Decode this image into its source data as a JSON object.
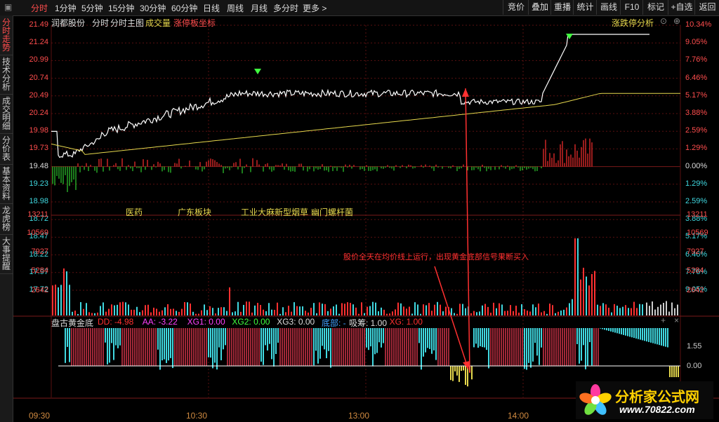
{
  "toolbar": {
    "corner": "▣",
    "periods": [
      "分时",
      "1分钟",
      "5分钟",
      "15分钟",
      "30分钟",
      "60分钟",
      "日线",
      "周线",
      "月线",
      "多分时",
      "更多 >"
    ],
    "right_buttons": [
      "竞价",
      "叠加",
      "重播",
      "统计",
      "画线",
      "F10",
      "标记",
      "+自选",
      "返回"
    ]
  },
  "left_tabs": [
    "分时走势",
    "技术分析",
    "成交明细",
    "分价表",
    "基本资料",
    "龙虎榜",
    "大事提醒"
  ],
  "header": {
    "stock": "润都股份",
    "mode": "分时",
    "main_chart": "分时主图",
    "volume_label": "成交量",
    "limit_label": "涨停板坐标",
    "analysis_link": "涨跌停分析"
  },
  "price_axis": {
    "left": [
      "21.49",
      "21.24",
      "20.99",
      "20.74",
      "20.49",
      "20.24",
      "19.98",
      "19.73",
      "19.48",
      "19.23",
      "18.98",
      "18.72",
      "18.47",
      "18.22",
      "17.97",
      "17.72"
    ],
    "right": [
      "10.34%",
      "9.05%",
      "7.76%",
      "6.46%",
      "5.17%",
      "3.88%",
      "2.59%",
      "1.29%",
      "0.00%",
      "1.29%",
      "2.59%",
      "3.88%",
      "5.17%",
      "6.46%",
      "7.76%",
      "9.05%"
    ]
  },
  "volume_axis": [
    "13211",
    "10569",
    "7927",
    "5284",
    "2642"
  ],
  "sectors": [
    "医药",
    "广东板块",
    "工业大麻",
    "新型烟草",
    "幽门螺杆菌"
  ],
  "annotation": "股价全天在均价线上运行，出现黄金底部信号果断买入",
  "indicator": {
    "name": "盘古黄金底",
    "params": [
      {
        "label": "DD: -4.98",
        "color": "#ff3030"
      },
      {
        "label": "AA: -3.22",
        "color": "#ff40ff"
      },
      {
        "label": "XG1: 0.00",
        "color": "#ff40ff"
      },
      {
        "label": "XG2: 0.00",
        "color": "#40ff40"
      },
      {
        "label": "XG3: 0.00",
        "color": "#dddddd"
      },
      {
        "label": "底部: -",
        "color": "#40a0ff"
      },
      {
        "label": "吸筹: 1.00",
        "color": "#dddddd"
      },
      {
        "label": "XG: 1.00",
        "color": "#ff3030"
      }
    ],
    "axis": [
      "1.55",
      "0.00"
    ]
  },
  "time_axis": [
    "09:30",
    "10:30",
    "13:00",
    "14:00"
  ],
  "logo": {
    "title": "分析家公式网",
    "url": "www.70822.com"
  },
  "colors": {
    "up": "#ff3030",
    "down": "#30d030",
    "price_line": "#ffffff",
    "avg_line": "#e6d84d",
    "grid": "#5a1010",
    "cyan": "#40d8e0",
    "maroon": "#a02838"
  }
}
